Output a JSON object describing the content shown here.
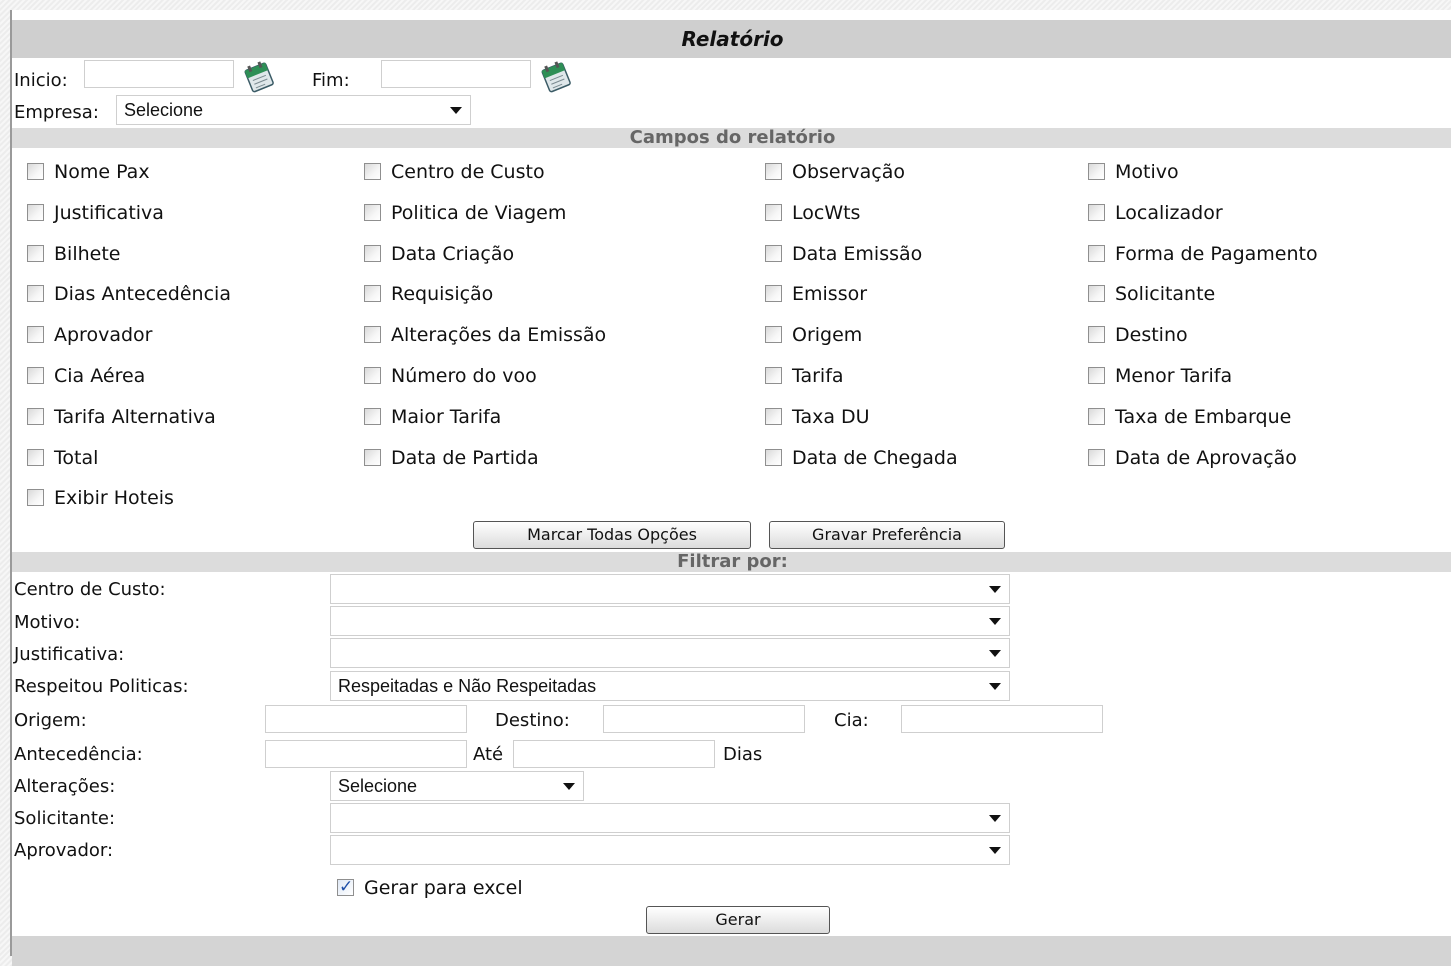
{
  "header": {
    "title": "Relatório"
  },
  "dates": {
    "inicio_label": "Inicio:",
    "inicio_value": "",
    "fim_label": "Fim:",
    "fim_value": ""
  },
  "empresa": {
    "label": "Empresa:",
    "selected": "Selecione"
  },
  "campos": {
    "title": "Campos do relatório",
    "items": [
      {
        "label": "Nome Pax",
        "checked": false
      },
      {
        "label": "Centro de Custo",
        "checked": false
      },
      {
        "label": "Observação",
        "checked": false
      },
      {
        "label": "Motivo",
        "checked": false
      },
      {
        "label": "Justificativa",
        "checked": false
      },
      {
        "label": "Politica de Viagem",
        "checked": false
      },
      {
        "label": "LocWts",
        "checked": false
      },
      {
        "label": "Localizador",
        "checked": false
      },
      {
        "label": "Bilhete",
        "checked": false
      },
      {
        "label": "Data Criação",
        "checked": false
      },
      {
        "label": "Data Emissão",
        "checked": false
      },
      {
        "label": "Forma de Pagamento",
        "checked": false
      },
      {
        "label": "Dias Antecedência",
        "checked": false
      },
      {
        "label": "Requisição",
        "checked": false
      },
      {
        "label": "Emissor",
        "checked": false
      },
      {
        "label": "Solicitante",
        "checked": false
      },
      {
        "label": "Aprovador",
        "checked": false
      },
      {
        "label": "Alterações da Emissão",
        "checked": false
      },
      {
        "label": "Origem",
        "checked": false
      },
      {
        "label": "Destino",
        "checked": false
      },
      {
        "label": "Cia Aérea",
        "checked": false
      },
      {
        "label": "Número do voo",
        "checked": false
      },
      {
        "label": "Tarifa",
        "checked": false
      },
      {
        "label": "Menor Tarifa",
        "checked": false
      },
      {
        "label": "Tarifa Alternativa",
        "checked": false
      },
      {
        "label": "Maior Tarifa",
        "checked": false
      },
      {
        "label": "Taxa DU",
        "checked": false
      },
      {
        "label": "Taxa de Embarque",
        "checked": false
      },
      {
        "label": "Total",
        "checked": false
      },
      {
        "label": "Data de Partida",
        "checked": false
      },
      {
        "label": "Data de Chegada",
        "checked": false
      },
      {
        "label": "Data de Aprovação",
        "checked": false
      },
      {
        "label": "Exibir Hoteis",
        "checked": false
      }
    ],
    "mark_all_button": "Marcar Todas Opções",
    "save_pref_button": "Gravar Preferência"
  },
  "filtros": {
    "title": "Filtrar por:",
    "centro_custo": {
      "label": "Centro de Custo:",
      "selected": ""
    },
    "motivo": {
      "label": "Motivo:",
      "selected": ""
    },
    "justificativa": {
      "label": "Justificativa:",
      "selected": ""
    },
    "respeitou": {
      "label": "Respeitou Politicas:",
      "selected": "Respeitadas e Não Respeitadas"
    },
    "origem": {
      "label": "Origem:",
      "value": ""
    },
    "destino": {
      "label": "Destino:",
      "value": ""
    },
    "cia": {
      "label": "Cia:",
      "value": ""
    },
    "antecedencia": {
      "label": "Antecedência:",
      "de": "",
      "ate_label": "Até",
      "ate": "",
      "dias_label": "Dias"
    },
    "alteracoes": {
      "label": "Alterações:",
      "selected": "Selecione"
    },
    "solicitante": {
      "label": "Solicitante:",
      "selected": ""
    },
    "aprovador": {
      "label": "Aprovador:",
      "selected": ""
    },
    "excel": {
      "label": "Gerar para excel",
      "checked": true
    },
    "gerar_button": "Gerar"
  }
}
